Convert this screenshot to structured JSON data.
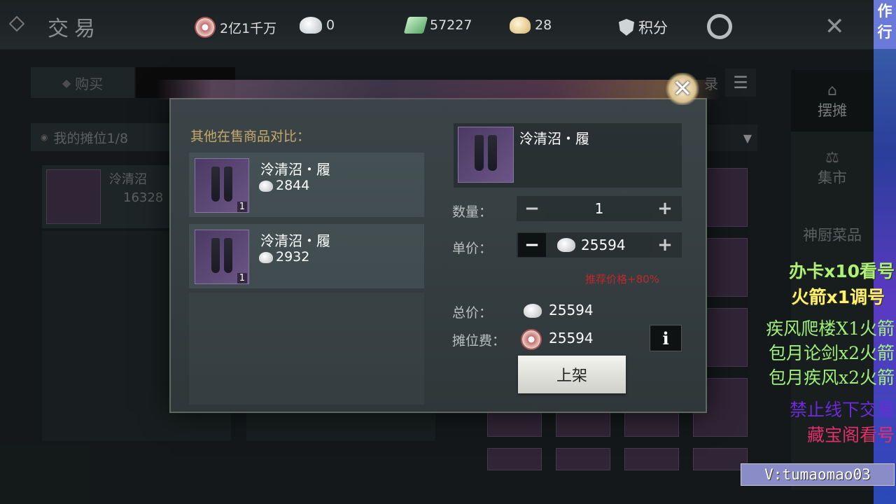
{
  "header": {
    "title": "交易",
    "resources": [
      {
        "icon": "copper-coin-icon",
        "value": "2亿1千万"
      },
      {
        "icon": "silver-ingot-plus-icon",
        "value": "0"
      },
      {
        "icon": "jade-icon",
        "value": "57227"
      },
      {
        "icon": "gold-ingot-icon",
        "value": "28"
      }
    ],
    "points_label": "积分"
  },
  "background": {
    "tab_buy": "购买",
    "my_stall": "我的摊位1/8",
    "stall_item_name": "泠清沼",
    "stall_item_price": "16328",
    "side_nav": [
      "摆摊",
      "集市",
      "神厨菜品"
    ],
    "record_label": "录"
  },
  "modal": {
    "compare_title": "其他在售商品对比：",
    "compare_items": [
      {
        "name": "泠清沼・履",
        "price": "2844",
        "qty": "1"
      },
      {
        "name": "泠清沼・履",
        "price": "2932",
        "qty": "1"
      }
    ],
    "item_name": "泠清沼・履",
    "quantity_label": "数量：",
    "quantity_value": "1",
    "unit_price_label": "单价：",
    "unit_price_value": "25594",
    "recommend_text": "推荐价格+80%",
    "total_label": "总价：",
    "total_value": "25594",
    "stall_fee_label": "摊位费：",
    "stall_fee_value": "25594",
    "info_label": "i",
    "list_button": "上架"
  },
  "overlay": {
    "corner": [
      "作",
      "行"
    ],
    "ads": [
      "办卡x10看号",
      "火箭x1调号",
      "疾风爬楼X1火箭",
      "包月论剑x2火箭",
      "包月疾风x2火箭",
      "禁止线下交易",
      "藏宝阁看号"
    ],
    "handle": "V:tumaomao03"
  },
  "colors": {
    "accent_gold": "#c8a86a",
    "recommend_red": "#c0282a",
    "ad_green": "#9ef07a",
    "ad_purple": "#6a2bd8",
    "ad_pink": "#e0306a"
  }
}
